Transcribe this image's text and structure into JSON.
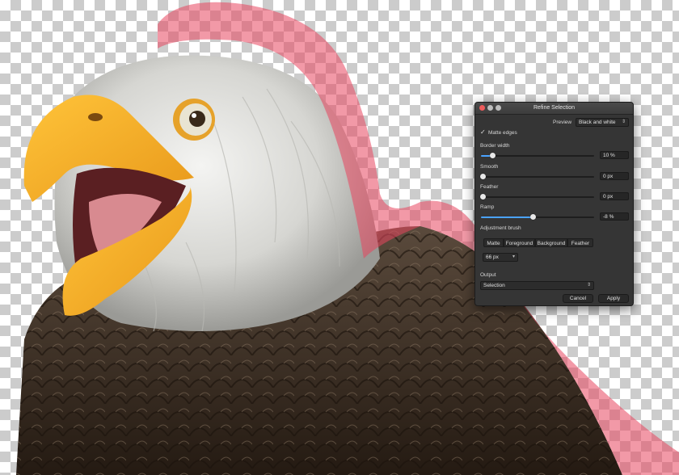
{
  "dialog": {
    "title": "Refine Selection",
    "preview_label": "Preview",
    "preview_value": "Black and white",
    "matte_edges_label": "Matte edges",
    "matte_edges_checked": true,
    "sliders": [
      {
        "label": "Border width",
        "value_text": "10 %",
        "fraction": 0.1
      },
      {
        "label": "Smooth",
        "value_text": "0 px",
        "fraction": 0.0
      },
      {
        "label": "Feather",
        "value_text": "0 px",
        "fraction": 0.0
      },
      {
        "label": "Ramp",
        "value_text": "-8 %",
        "fraction": 0.46
      }
    ],
    "adjustment_brush_label": "Adjustment brush",
    "brush_modes": [
      "Matte",
      "Foreground",
      "Background",
      "Feather"
    ],
    "brush_size": "66 px",
    "output_label": "Output",
    "output_value": "Selection",
    "cancel_label": "Cancel",
    "apply_label": "Apply"
  },
  "colors": {
    "accent": "#4aa3ff",
    "selection_overlay": "#e8455f",
    "panel": "#353535"
  }
}
